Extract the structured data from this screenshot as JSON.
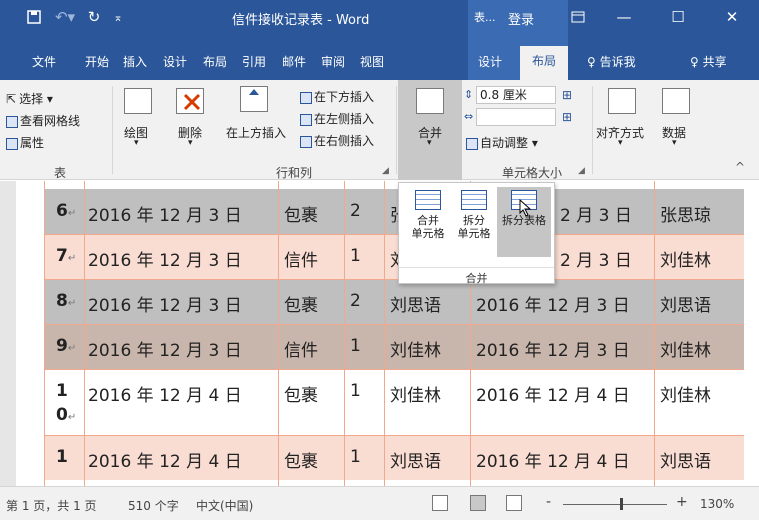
{
  "titlebar": {
    "save_icon": "save-icon",
    "undo_icon": "undo-icon",
    "redo_icon": "redo-icon",
    "customize_icon": "customize-qat-icon",
    "title": "信件接收记录表 - Word",
    "context_tool": "表...",
    "login": "登录",
    "ribbon_display_icon": "ribbon-display-icon",
    "minimize_glyph": "—",
    "maximize_glyph": "☐",
    "close_glyph": "✕"
  },
  "tabs": [
    "文件",
    "开始",
    "插入",
    "设计",
    "布局",
    "引用",
    "邮件",
    "审阅",
    "视图",
    "设计",
    "布局"
  ],
  "tell_me": "♀ 告诉我",
  "share": "♀ 共享",
  "ribbon": {
    "table_group": {
      "label": "表",
      "select": "选择 ▾",
      "view_gridlines": "查看网格线",
      "properties": "属性"
    },
    "draw": {
      "label": "绘图",
      "arrow": "▾"
    },
    "delete": {
      "label": "删除",
      "arrow": "▾"
    },
    "rows_cols": {
      "label": "行和列",
      "insert_above": "在上方插入",
      "insert_below": "在下方插入",
      "insert_left": "在左侧插入",
      "insert_right": "在右侧插入"
    },
    "merge": {
      "label": "合并",
      "arrow": "▾"
    },
    "cell_size": {
      "label": "单元格大小",
      "height_value": "0.8 厘米",
      "autofit": "自动调整 ▾"
    },
    "align": {
      "label": "对齐方式",
      "arrow": "▾"
    },
    "data": {
      "label": "数据",
      "arrow": "▾"
    },
    "collapse": "^"
  },
  "popup": {
    "merge_cells": [
      "合并",
      "单元格"
    ],
    "split_cells": [
      "拆分",
      "单元格"
    ],
    "split_table": "拆分表格",
    "group_label": "合并"
  },
  "rows": [
    {
      "num": "6",
      "date": "2016 年 12 月 3 日",
      "type": "包裹",
      "qty": "2",
      "name": "张",
      "date2": "2 月 3 日",
      "name2": "张思琼",
      "color": "gray"
    },
    {
      "num": "7",
      "date": "2016 年 12 月 3 日",
      "type": "信件",
      "qty": "1",
      "name": "刘",
      "date2": "2 月 3 日",
      "name2": "刘佳林",
      "color": "pink"
    },
    {
      "num": "8",
      "date": "2016 年 12 月 3 日",
      "type": "包裹",
      "qty": "2",
      "name": "刘思语",
      "date2": "2016 年 12 月 3 日",
      "name2": "刘思语",
      "color": "gray"
    },
    {
      "num": "9",
      "date": "2016 年 12 月 3 日",
      "type": "信件",
      "qty": "1",
      "name": "刘佳林",
      "date2": "2016 年 12 月 3 日",
      "name2": "刘佳林",
      "color": "tan"
    },
    {
      "num": "1",
      "num2": "0",
      "date": "2016 年 12 月 4 日",
      "type": "包裹",
      "qty": "1",
      "name": "刘佳林",
      "date2": "2016 年 12 月 4 日",
      "name2": "刘佳林",
      "color": "white"
    },
    {
      "num": "1",
      "date": "2016 年 12 月 4 日",
      "type": "包裹",
      "qty": "1",
      "name": "刘思语",
      "date2": "2016 年 12 月 4 日",
      "name2": "刘思语",
      "color": "pink"
    }
  ],
  "para_mark": "↵",
  "status": {
    "page": "第 1 页，共 1 页",
    "words": "510 个字",
    "lang": "中文(中国)",
    "zoom_minus": "-",
    "zoom_plus": "+",
    "zoom": "130%"
  }
}
